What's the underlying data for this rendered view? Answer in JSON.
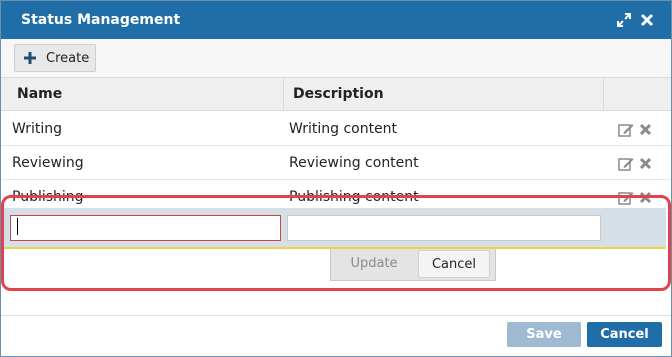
{
  "dialog": {
    "title": "Status Management",
    "maximize_icon": "expand-arrows-icon",
    "close_icon": "close-x-icon"
  },
  "toolbar": {
    "create_label": "Create",
    "create_icon": "plus-icon"
  },
  "grid": {
    "columns": [
      "Name",
      "Description"
    ],
    "rows": [
      {
        "name": "Writing",
        "description": "Writing content"
      },
      {
        "name": "Reviewing",
        "description": "Reviewing content"
      },
      {
        "name": "Publishing",
        "description": "Publishing content"
      }
    ],
    "row_icons": [
      "edit-icon",
      "delete-icon"
    ]
  },
  "editor": {
    "name_value": "",
    "description_value": "",
    "update_label": "Update",
    "cancel_label": "Cancel"
  },
  "footer": {
    "save_label": "Save",
    "cancel_label": "Cancel"
  },
  "colors": {
    "titlebar": "#1f6ea8",
    "highlight": "#e0434b",
    "editor_row": "#d5dfe8",
    "save_disabled": "#9fbbd3"
  }
}
